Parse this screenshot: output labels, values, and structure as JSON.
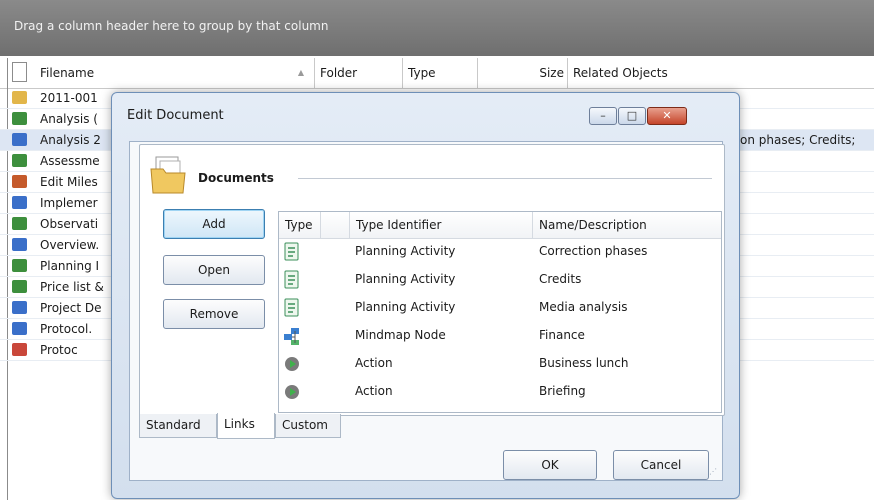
{
  "grid": {
    "group_hint": "Drag a column header here to group by that column",
    "columns": [
      "Filename",
      "Folder",
      "Type",
      "Size",
      "Related Objects"
    ],
    "rows": [
      {
        "name": "2011-001",
        "icon": "envelope-icon",
        "color": "#e2b64a"
      },
      {
        "name": "Analysis (",
        "icon": "spreadsheet-icon",
        "color": "#3d8f3d"
      },
      {
        "name": "Analysis 2",
        "icon": "word-doc-icon",
        "color": "#3a6fc9",
        "selected": true,
        "related": "on phases; Credits;"
      },
      {
        "name": "Assessme",
        "icon": "spreadsheet-icon",
        "color": "#3d8f3d"
      },
      {
        "name": "Edit Miles",
        "icon": "project-icon",
        "color": "#c55a2b"
      },
      {
        "name": "Implemer",
        "icon": "word-doc-icon",
        "color": "#3a6fc9"
      },
      {
        "name": "Observati",
        "icon": "spreadsheet-icon",
        "color": "#3d8f3d"
      },
      {
        "name": "Overview.",
        "icon": "word-doc-icon",
        "color": "#3a6fc9"
      },
      {
        "name": "Planning I",
        "icon": "spreadsheet-icon",
        "color": "#3d8f3d"
      },
      {
        "name": "Price list &",
        "icon": "spreadsheet-icon",
        "color": "#3d8f3d"
      },
      {
        "name": "Project De",
        "icon": "word-doc-icon",
        "color": "#3a6fc9"
      },
      {
        "name": "Protocol.",
        "icon": "word-doc-icon",
        "color": "#3a6fc9"
      },
      {
        "name": "Protoc",
        "icon": "pdf-icon",
        "color": "#c9473a"
      }
    ]
  },
  "dialog": {
    "title": "Edit Document",
    "section_title": "Documents",
    "buttons": {
      "add": "Add",
      "open": "Open",
      "remove": "Remove",
      "ok": "OK",
      "cancel": "Cancel"
    },
    "window_buttons": {
      "minimize": "–",
      "maximize": "□",
      "close": "✕"
    },
    "list_columns": [
      "Type",
      "Type Identifier",
      "Name/Description"
    ],
    "links": [
      {
        "icon": "planning-activity-icon",
        "type_id": "Planning Activity",
        "name": "Correction phases"
      },
      {
        "icon": "planning-activity-icon",
        "type_id": "Planning Activity",
        "name": "Credits"
      },
      {
        "icon": "planning-activity-icon",
        "type_id": "Planning Activity",
        "name": "Media analysis"
      },
      {
        "icon": "mindmap-node-icon",
        "type_id": "Mindmap Node",
        "name": "Finance"
      },
      {
        "icon": "action-icon",
        "type_id": "Action",
        "name": "Business lunch"
      },
      {
        "icon": "action-icon",
        "type_id": "Action",
        "name": "Briefing"
      }
    ],
    "tabs": [
      {
        "label": "Standard",
        "active": false
      },
      {
        "label": "Links",
        "active": true
      },
      {
        "label": "Custom",
        "active": false
      }
    ]
  }
}
